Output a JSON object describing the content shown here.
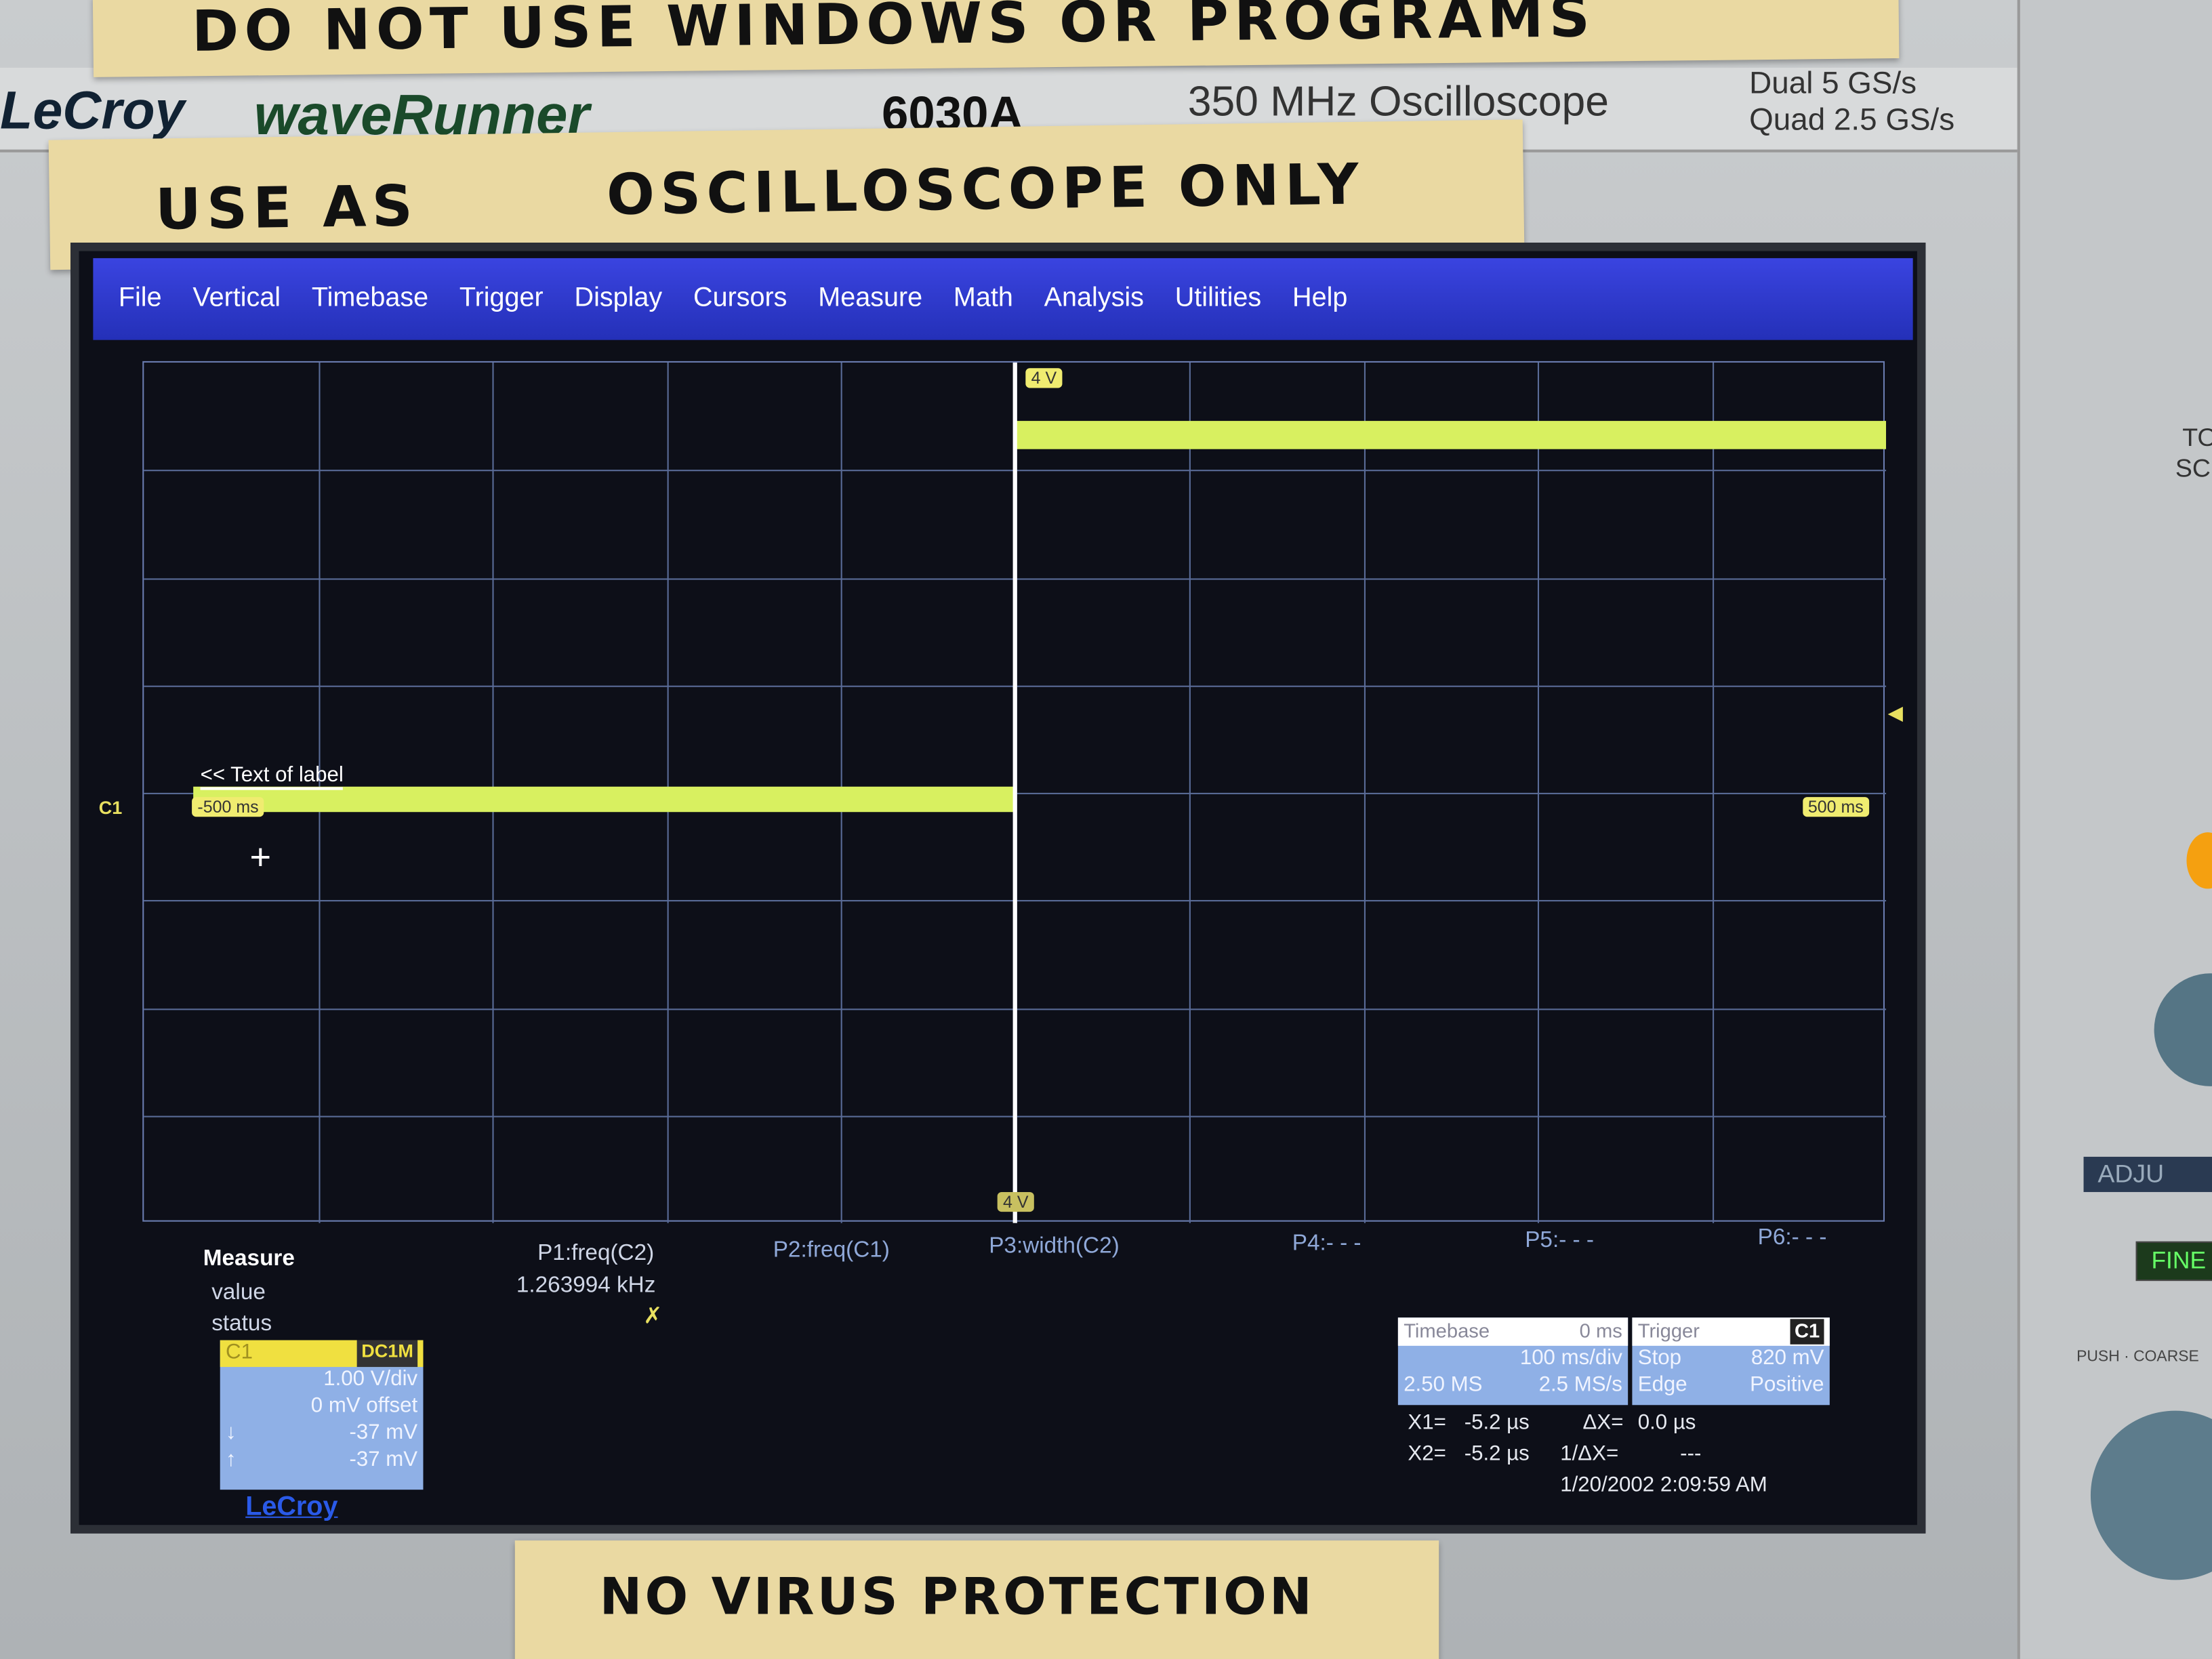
{
  "tapes": {
    "top": "DO NOT USE WINDOWS OR PROGRAMS",
    "middle_left": "USE AS",
    "middle_right": "OSCILLOSCOPE ONLY",
    "bottom": "NO VIRUS PROTECTION"
  },
  "brand": {
    "maker": "LeCroy",
    "model_logo": "waveRunner",
    "model": "6030A",
    "description": "350 MHz Oscilloscope",
    "spec1": "Dual 5 GS/s",
    "spec2": "Quad 2.5 GS/s"
  },
  "menu": [
    "File",
    "Vertical",
    "Timebase",
    "Trigger",
    "Display",
    "Cursors",
    "Measure",
    "Math",
    "Analysis",
    "Utilities",
    "Help"
  ],
  "grid": {
    "label_text": "<< Text of label",
    "channel": "C1",
    "left_marker": "-500 ms",
    "right_marker": "500 ms",
    "top_marker": "4 V",
    "bottom_marker": "4 V"
  },
  "trace": {
    "color": "#d8f060",
    "low_level_div": -0.1,
    "high_level_div": 3.3,
    "step_time_div": 0
  },
  "measure": {
    "title": "Measure",
    "value_label": "value",
    "status_label": "status",
    "params": [
      {
        "name": "P1:freq(C2)",
        "value": "1.263994 kHz",
        "status": "✗"
      },
      {
        "name": "P2:freq(C1)"
      },
      {
        "name": "P3:width(C2)"
      },
      {
        "name": "P4:- - -"
      },
      {
        "name": "P5:- - -"
      },
      {
        "name": "P6:- - -"
      }
    ]
  },
  "channel": {
    "name": "C1",
    "coupling": "DC1M",
    "vdiv": "1.00 V/div",
    "offset": "0 mV offset",
    "val1": "-37 mV",
    "val2": "-37 mV",
    "logo": "LeCroy"
  },
  "timebase": {
    "title": "Timebase",
    "delay": "0 ms",
    "tdiv": "100 ms/div",
    "samples": "2.50 MS",
    "rate": "2.5 MS/s"
  },
  "trigger": {
    "title": "Trigger",
    "source": "C1",
    "mode": "Stop",
    "level": "820 mV",
    "type": "Edge",
    "slope": "Positive"
  },
  "cursors": {
    "x1_label": "X1=",
    "x1": "-5.2 µs",
    "dx_label": "ΔX=",
    "dx": "0.0 µs",
    "x2_label": "X2=",
    "x2": "-5.2 µs",
    "inv_label": "1/ΔX=",
    "inv": "---"
  },
  "datetime": "1/20/2002 2:09:59 AM",
  "panel": {
    "fine": "FINE",
    "adjust": "ADJU",
    "push": "PUSH · COARSE",
    "to": "TO",
    "sc": "SCI"
  }
}
